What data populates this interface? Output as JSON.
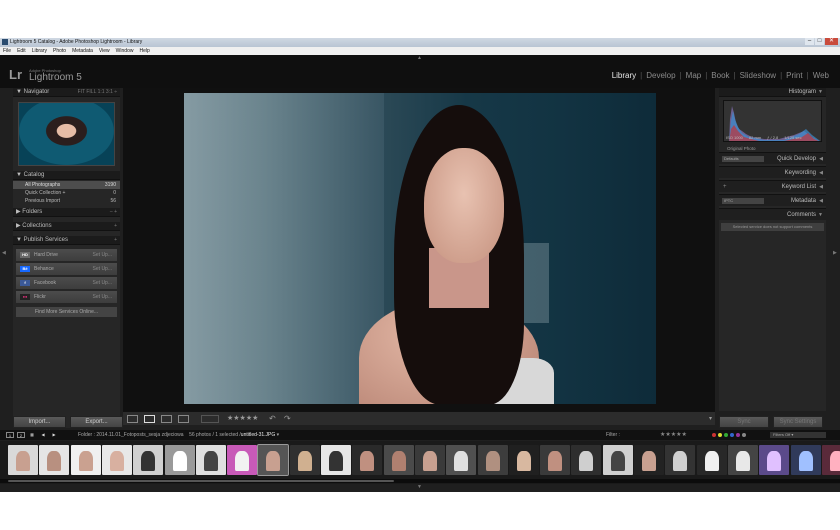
{
  "window": {
    "title": "Lightroom 5 Catalog - Adobe Photoshop Lightroom - Library",
    "controls": [
      "–",
      "□",
      "✕"
    ]
  },
  "menu": [
    "File",
    "Edit",
    "Library",
    "Photo",
    "Metadata",
    "View",
    "Window",
    "Help"
  ],
  "brand": {
    "logo": "Lr",
    "sub": "Adobe Photoshop",
    "name": "Lightroom 5"
  },
  "modules": [
    {
      "label": "Library",
      "active": true
    },
    {
      "label": "Develop",
      "active": false
    },
    {
      "label": "Map",
      "active": false
    },
    {
      "label": "Book",
      "active": false
    },
    {
      "label": "Slideshow",
      "active": false
    },
    {
      "label": "Print",
      "active": false
    },
    {
      "label": "Web",
      "active": false
    }
  ],
  "left": {
    "navigator": {
      "title": "Navigator",
      "zoom": "FIT  FILL  1:1  3:1 ÷"
    },
    "catalog": {
      "title": "Catalog",
      "rows": [
        {
          "label": "All Photographs",
          "count": "3190"
        },
        {
          "label": "Quick Collection +",
          "count": "0"
        },
        {
          "label": "Previous Import",
          "count": "56"
        }
      ]
    },
    "folders": {
      "title": "Folders",
      "ctrl": "– +"
    },
    "collections": {
      "title": "Collections",
      "ctrl": "+"
    },
    "publish": {
      "title": "Publish Services",
      "ctrl": "+",
      "services": [
        {
          "icon": "HD",
          "label": "Hard Drive",
          "action": "Set Up...",
          "color": "#6a6a6a"
        },
        {
          "icon": "Bē",
          "label": "Behance",
          "action": "Set Up...",
          "color": "#1769ff"
        },
        {
          "icon": "f",
          "label": "Facebook",
          "action": "Set Up...",
          "color": "#3b5998"
        },
        {
          "icon": "●●",
          "label": "Flickr",
          "action": "Set Up...",
          "color": "#222222"
        }
      ],
      "find_more": "Find More Services Online..."
    },
    "import_label": "Import...",
    "export_label": "Export..."
  },
  "right": {
    "histogram": {
      "title": "Histogram",
      "iso": "ISO 1000",
      "focal": "82 mm",
      "aperture": "ƒ / 2,8",
      "shutter": "1/125 sec",
      "original": "Original Photo"
    },
    "quick_develop": {
      "title": "Quick Develop",
      "preset": "Defaults"
    },
    "keywording": {
      "title": "Keywording"
    },
    "keyword_list": {
      "title": "Keyword List",
      "ctrl": "+"
    },
    "metadata": {
      "title": "Metadata",
      "preset": "IPTC"
    },
    "comments": {
      "title": "Comments",
      "note": "Selected service does not support comments"
    },
    "sync_label": "Sync",
    "sync_settings_label": "Sync Settings"
  },
  "toolbar": {
    "stars": "★★★★★",
    "rotate_left": "↶",
    "rotate_right": "↷",
    "dropdown": "▾"
  },
  "filmstrip_bar": {
    "path": "Folder : 2014.11.01_Fotoposts_sesja zdjeciowa",
    "count": "56 photos / 1 selected /",
    "file": "untitled-31.JPG",
    "filter_label": "Filter :",
    "stars": "★★★★★",
    "filters_off": "Filters Off",
    "dot_colors": [
      "#c33",
      "#dd3",
      "#3a3",
      "#36c",
      "#939",
      "#888"
    ]
  },
  "thumbs_count": "32"
}
